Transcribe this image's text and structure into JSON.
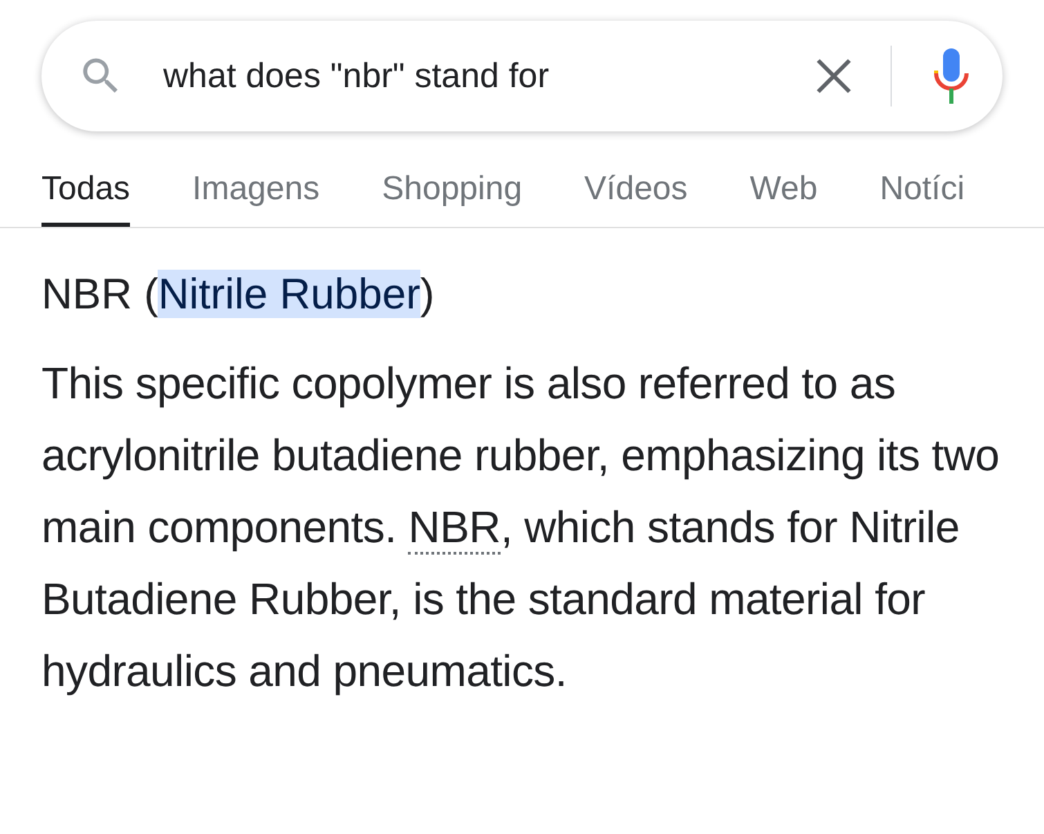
{
  "search": {
    "value": "what does \"nbr\" stand for"
  },
  "tabs": [
    {
      "label": "Todas",
      "selected": true
    },
    {
      "label": "Imagens",
      "selected": false
    },
    {
      "label": "Shopping",
      "selected": false
    },
    {
      "label": "Vídeos",
      "selected": false
    },
    {
      "label": "Web",
      "selected": false
    },
    {
      "label": "Notíci",
      "selected": false
    }
  ],
  "answer": {
    "heading": {
      "before": "NBR (",
      "highlighted": "Nitrile Rubber",
      "after": ")"
    },
    "paragraph": {
      "before": "This specific copolymer is also referred to as acrylonitrile butadiene rubber, emphasizing its two main components. ",
      "term": "NBR",
      "after": ", which stands for Nitrile Butadiene Rubber, is the standard material for hydraulics and pneumatics."
    }
  }
}
